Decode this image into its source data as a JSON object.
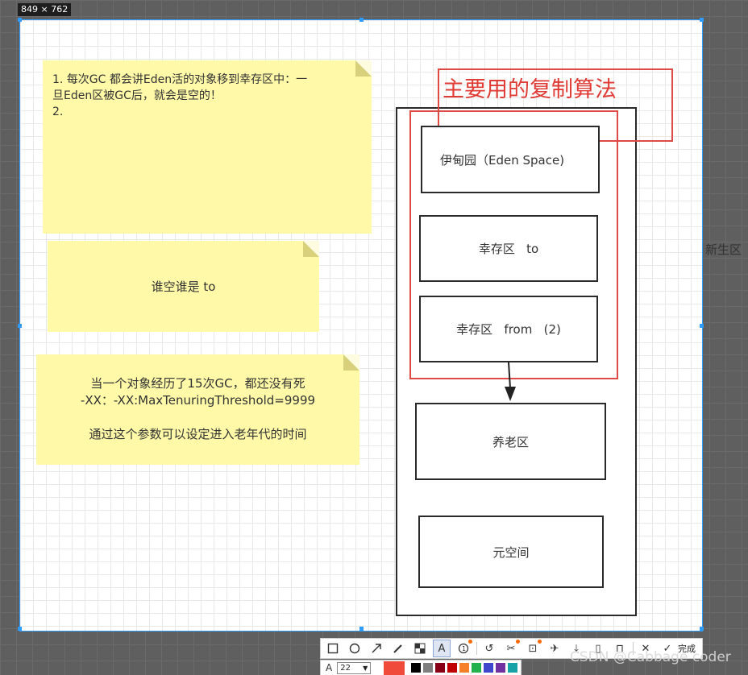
{
  "size_label": "849 × 762",
  "notes": {
    "first": "1. 每次GC 都会讲Eden活的对象移到幸存区中：一\n旦Eden区被GC后，就会是空的！\n2.",
    "second": "谁空谁是 to",
    "third": "当一个对象经历了15次GC，都还没有死\n-XX：-XX:MaxTenuringThreshold=9999\n\n通过这个参数可以设定进入老年代的时间"
  },
  "diagram": {
    "title": "主要用的复制算法",
    "eden": "伊甸园（Eden Space)",
    "survivor_to": "幸存区   to",
    "survivor_from": "幸存区   from   (2)",
    "old_gen": "养老区",
    "metaspace": "元空间",
    "young_gen_label": "新生区"
  },
  "toolbar": {
    "done_label": "完成",
    "font_size": "22",
    "icons": [
      "rect-icon",
      "ellipse-icon",
      "arrow-icon",
      "pen-icon",
      "mosaic-icon",
      "text-icon",
      "number-icon",
      "undo-icon",
      "pin-icon",
      "ocr-icon",
      "translate-icon",
      "save-icon",
      "copy-icon",
      "bookmark-icon",
      "close-icon",
      "check-icon"
    ],
    "selected_color": "#f04a3a",
    "palette": [
      "#000000",
      "#7f7f7f",
      "#880015",
      "#c00000",
      "#f6812a",
      "#22b14c",
      "#3f48cc",
      "#7030a0",
      "#17a2a8"
    ]
  },
  "watermark": "CSDN @Cabbage coder"
}
